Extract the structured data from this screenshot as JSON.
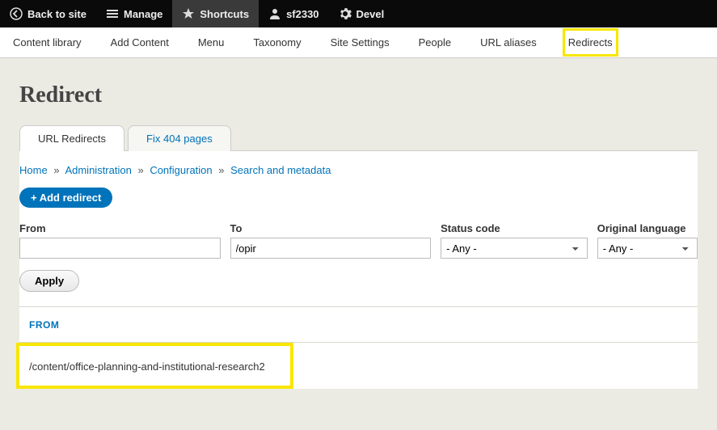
{
  "topbar": {
    "back": "Back to site",
    "manage": "Manage",
    "shortcuts": "Shortcuts",
    "user": "sf2330",
    "devel": "Devel"
  },
  "toolbar": {
    "items": [
      "Content library",
      "Add Content",
      "Menu",
      "Taxonomy",
      "Site Settings",
      "People",
      "URL aliases",
      "Redirects"
    ]
  },
  "page_title": "Redirect",
  "tabs": {
    "items": [
      "URL Redirects",
      "Fix 404 pages"
    ],
    "active_index": 0
  },
  "breadcrumb": {
    "home": "Home",
    "admin": "Administration",
    "config": "Configuration",
    "search": "Search and metadata"
  },
  "buttons": {
    "add_redirect": "+ Add redirect",
    "apply": "Apply"
  },
  "filters": {
    "from_label": "From",
    "from_value": "",
    "to_label": "To",
    "to_value": "/opir",
    "status_label": "Status code",
    "status_value": "- Any -",
    "lang_label": "Original language",
    "lang_value": "- Any -"
  },
  "table": {
    "col_from": "FROM",
    "rows": [
      {
        "from": "/content/office-planning-and-institutional-research2"
      }
    ]
  }
}
